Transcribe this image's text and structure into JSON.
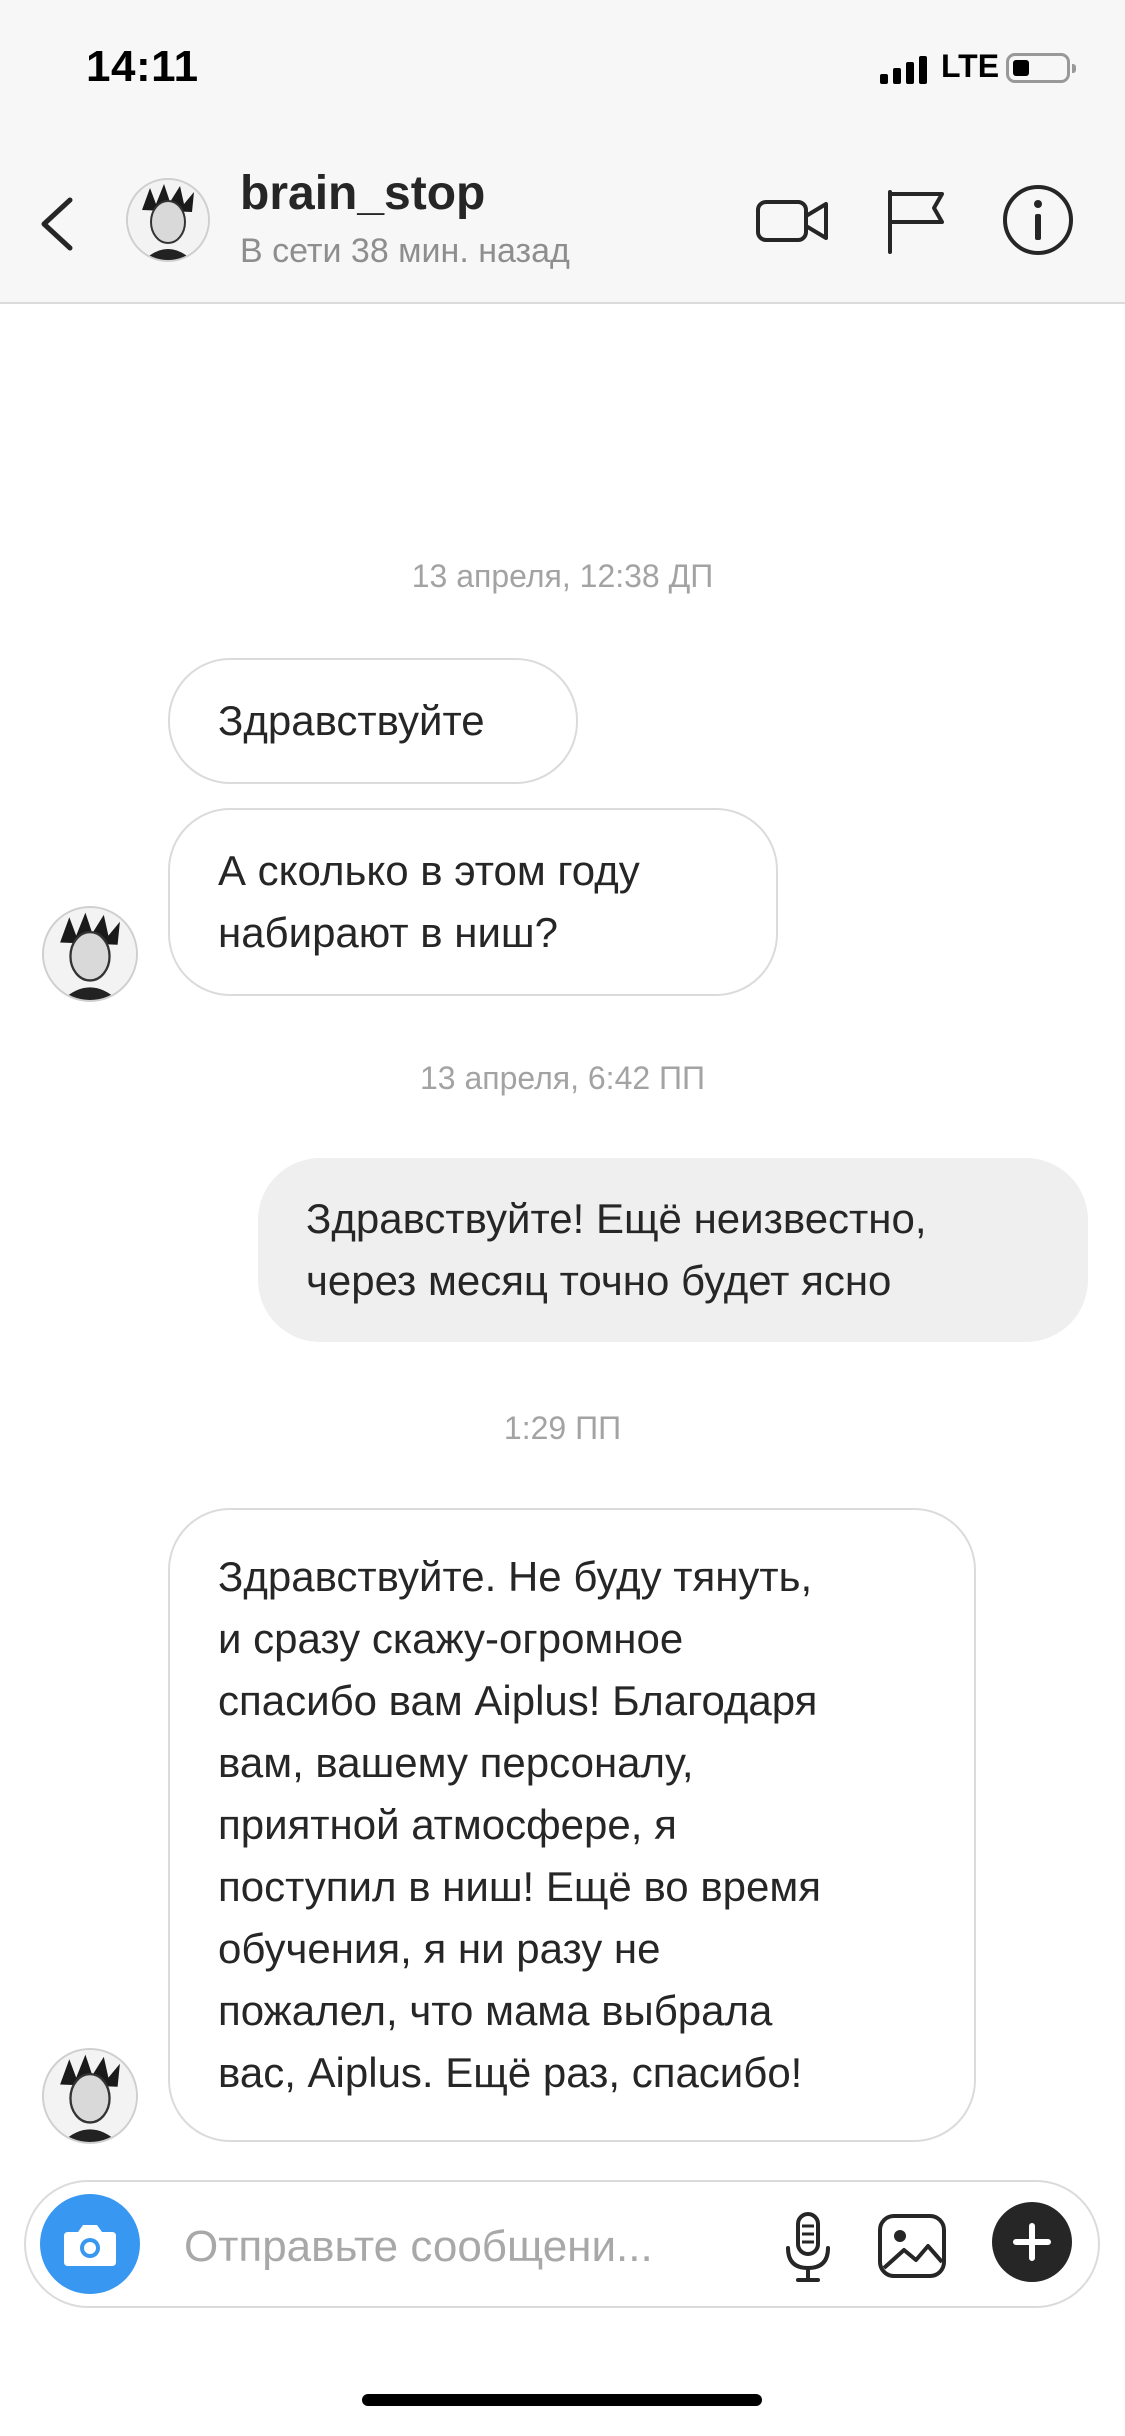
{
  "status": {
    "time": "14:11",
    "network": "LTE"
  },
  "header": {
    "username": "brain_stop",
    "presence": "В сети 38 мин. назад",
    "icons": [
      "back-chevron-icon",
      "video-call-icon",
      "flag-report-icon",
      "info-icon"
    ]
  },
  "conversation": {
    "timestamps": [
      "13 апреля, 12:38 ДП",
      "13 апреля, 6:42 ПП",
      "1:29 ПП"
    ],
    "messages": [
      {
        "direction": "incoming",
        "lines": [
          "Здравствуйте"
        ]
      },
      {
        "direction": "incoming",
        "lines": [
          "А сколько в этом году",
          "набирают в ниш?"
        ]
      },
      {
        "direction": "outgoing",
        "lines": [
          "Здравствуйте! Ещё неизвестно,",
          "через месяц точно будет ясно"
        ]
      },
      {
        "direction": "incoming",
        "lines": [
          "Здравствуйте. Не буду тянуть,",
          "и сразу скажу-огромное",
          "спасибо вам Aiplus! Благодаря",
          "вам, вашему персоналу,",
          "приятной атмосфере, я",
          "поступил в ниш! Ещё во время",
          "обучения, я ни разу не",
          "пожалел, что мама выбрала",
          "вас, Aiplus. Ещё раз, спасибо!"
        ]
      }
    ]
  },
  "composer": {
    "placeholder": "Отправьте сообщени...",
    "icons": [
      "camera-icon",
      "microphone-icon",
      "gallery-icon",
      "plus-icon"
    ]
  },
  "colors": {
    "accent": "#3897f0",
    "bubble_out": "#efefef",
    "border": "#dbdbdb",
    "muted": "#8e8e8e"
  }
}
